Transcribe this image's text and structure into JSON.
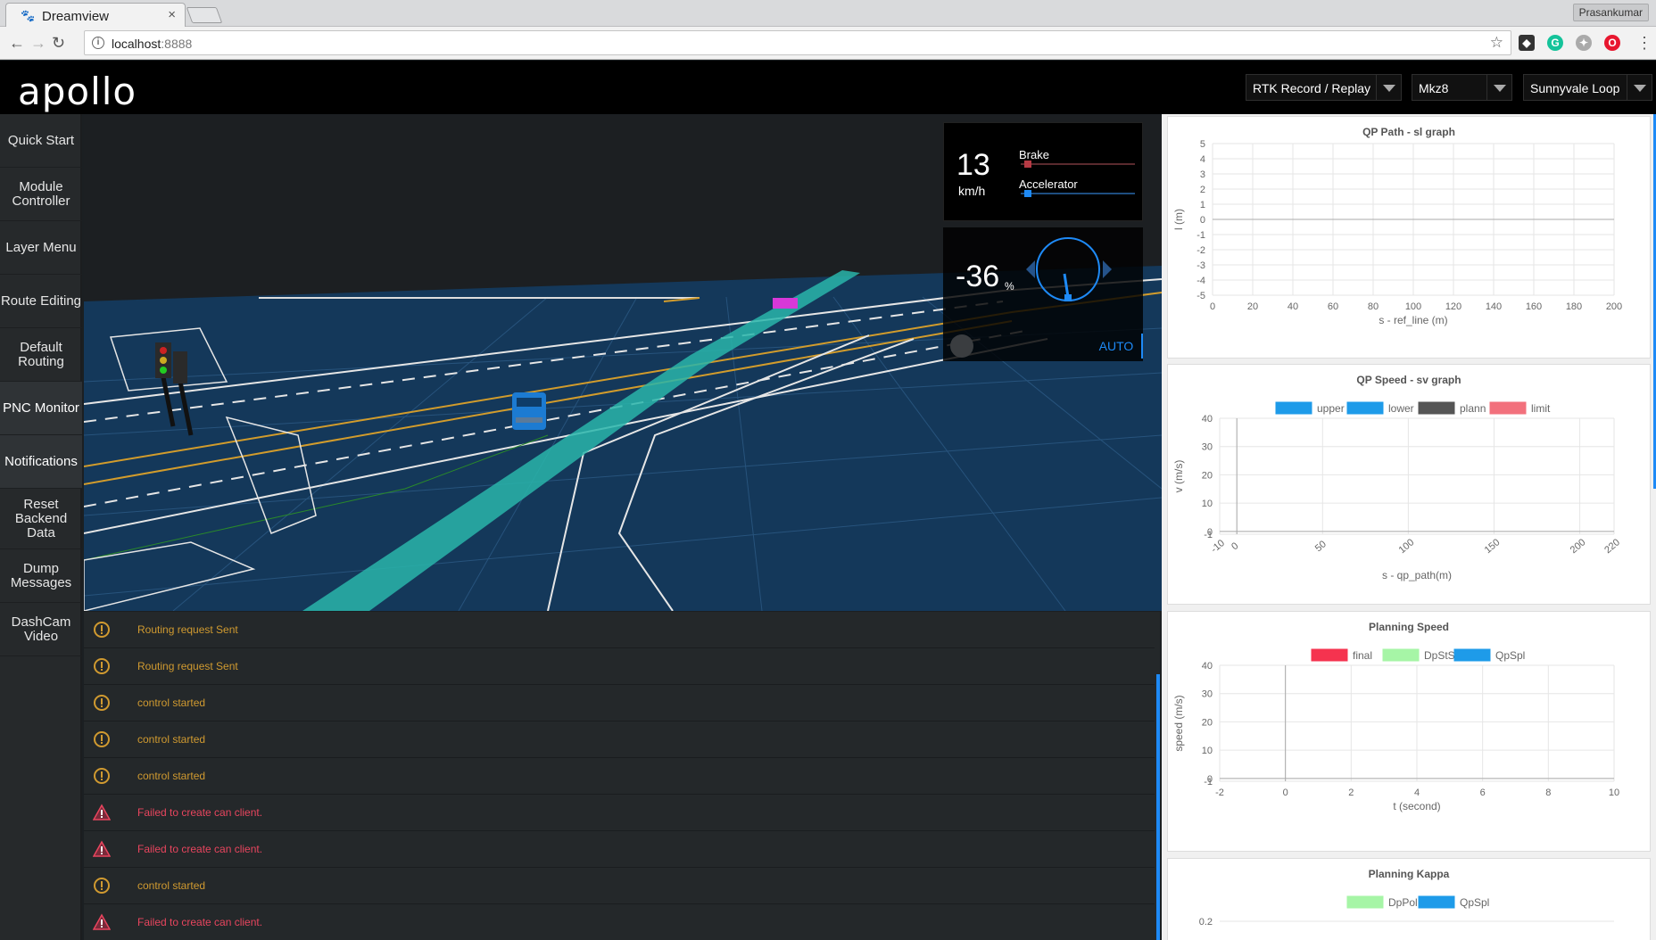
{
  "browser": {
    "tab_title": "Dreamview",
    "tab_close": "×",
    "url_host": "localhost",
    "url_port": ":8888",
    "profile_name": "Prasankumar"
  },
  "header": {
    "logo": "apollo",
    "mode_select": "RTK Record / Replay",
    "vehicle_select": "Mkz8",
    "map_select": "Sunnyvale Loop"
  },
  "sidebar": {
    "items": [
      {
        "label": "Quick Start"
      },
      {
        "label": "Module Controller"
      },
      {
        "label": "Layer Menu"
      },
      {
        "label": "Route Editing"
      },
      {
        "label": "Default Routing"
      },
      {
        "label": "PNC Monitor"
      },
      {
        "label": "Notifications"
      },
      {
        "label": "Reset Backend Data"
      },
      {
        "label": "Dump Messages"
      },
      {
        "label": "DashCam Video"
      }
    ]
  },
  "dashboard": {
    "speed": "13",
    "speed_unit": "km/h",
    "brake_label": "Brake",
    "accelerator_label": "Accelerator",
    "brake_level": 0.03,
    "accelerator_level": 0.03,
    "steering": "-36",
    "steering_unit": "%",
    "driving_mode": "AUTO",
    "colors": {
      "brake": "#b73a44",
      "accelerator": "#1e8af6"
    }
  },
  "console": {
    "messages": [
      {
        "level": "warn",
        "text": "Routing request Sent"
      },
      {
        "level": "warn",
        "text": "Routing request Sent"
      },
      {
        "level": "warn",
        "text": "control started"
      },
      {
        "level": "warn",
        "text": "control started"
      },
      {
        "level": "warn",
        "text": "control started"
      },
      {
        "level": "error",
        "text": "Failed to create can client."
      },
      {
        "level": "error",
        "text": "Failed to create can client."
      },
      {
        "level": "warn",
        "text": "control started"
      },
      {
        "level": "error",
        "text": "Failed to create can client."
      }
    ]
  },
  "chart_data": [
    {
      "type": "line",
      "title": "QP Path - sl graph",
      "xlabel": "s - ref_line (m)",
      "ylabel": "l (m)",
      "xlim": [
        0,
        200
      ],
      "ylim": [
        -5,
        5
      ],
      "x_ticks": [
        "0",
        "20",
        "40",
        "60",
        "80",
        "100",
        "120",
        "140",
        "160",
        "180",
        "200"
      ],
      "y_ticks": [
        "5",
        "4",
        "3",
        "2",
        "1",
        "0",
        "-1",
        "-2",
        "-3",
        "-4",
        "-5"
      ],
      "series": []
    },
    {
      "type": "line",
      "title": "QP Speed - sv graph",
      "xlabel": "s - qp_path(m)",
      "ylabel": "v (m/s)",
      "xlim": [
        -10,
        220
      ],
      "ylim": [
        -1,
        40
      ],
      "x_ticks": [
        "-10",
        "0",
        "50",
        "100",
        "150",
        "200",
        "220"
      ],
      "y_ticks": [
        "40",
        "30",
        "20",
        "10",
        "0",
        "-1"
      ],
      "legend": [
        {
          "name": "upper",
          "color": "#1e9be9"
        },
        {
          "name": "lower",
          "color": "#1e9be9"
        },
        {
          "name": "plann",
          "color": "#555555"
        },
        {
          "name": "limit",
          "color": "#f2707c"
        }
      ],
      "series": []
    },
    {
      "type": "line",
      "title": "Planning Speed",
      "xlabel": "t (second)",
      "ylabel": "speed (m/s)",
      "xlim": [
        -2,
        10
      ],
      "ylim": [
        -1,
        40
      ],
      "x_ticks": [
        "-2",
        "0",
        "2",
        "4",
        "6",
        "8",
        "10"
      ],
      "y_ticks": [
        "40",
        "30",
        "20",
        "10",
        "0",
        "-1"
      ],
      "legend": [
        {
          "name": "final",
          "color": "#f5334f"
        },
        {
          "name": "DpStS",
          "color": "#a6f5a6"
        },
        {
          "name": "QpSpl",
          "color": "#1e9be9"
        }
      ],
      "series": []
    },
    {
      "type": "line",
      "title": "Planning Kappa",
      "xlabel": "",
      "ylabel": "",
      "y_ticks": [
        "0.2"
      ],
      "legend": [
        {
          "name": "DpPol",
          "color": "#a6f5a6"
        },
        {
          "name": "QpSpl",
          "color": "#1e9be9"
        }
      ],
      "series": []
    }
  ]
}
